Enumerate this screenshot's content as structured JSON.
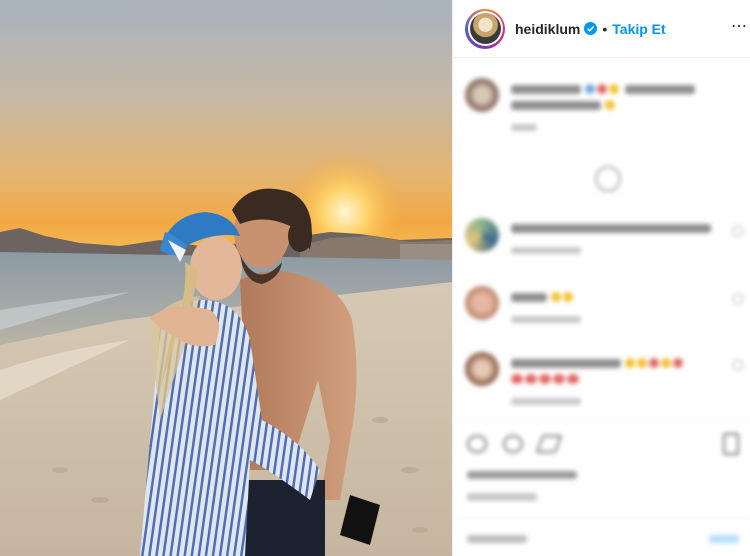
{
  "header": {
    "username": "heidiklum",
    "separator": "•",
    "follow_label": "Takip Et",
    "more_icon": "⋯",
    "verified_color": "#0095f6"
  },
  "colors": {
    "accent": "#0095f6",
    "text": "#262626"
  }
}
